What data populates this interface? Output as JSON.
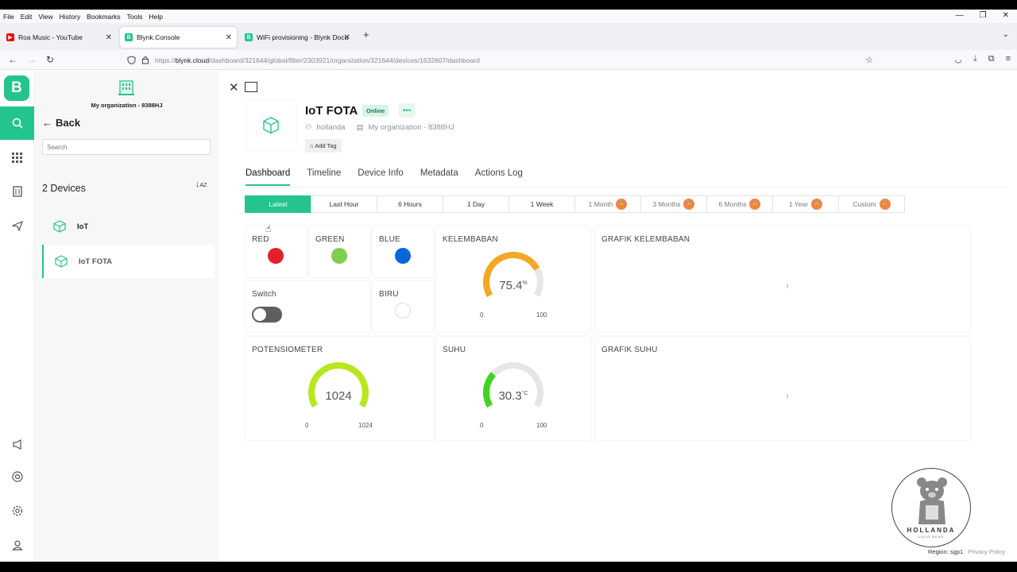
{
  "browser": {
    "menu": [
      "File",
      "Edit",
      "View",
      "History",
      "Bookmarks",
      "Tools",
      "Help"
    ],
    "tabs": [
      {
        "title": "Roa Music - YouTube",
        "favicon_color": "#ff0000"
      },
      {
        "title": "Blynk.Console",
        "favicon_color": "#23c48e"
      },
      {
        "title": "WiFi provisioning - Blynk Docu",
        "favicon_color": "#23c48e"
      }
    ],
    "url_prefix": "https://",
    "url_host": "blynk.cloud",
    "url_path": "/dashboard/321644/global/filter/2303921/organization/321644/devices/1632607/dashboard"
  },
  "rail": {
    "logo": "B"
  },
  "panel": {
    "org_name": "My organization - 8388HJ",
    "back": "Back",
    "search_placeholder": "Search",
    "device_count": "2 Devices",
    "devices": [
      {
        "name": "IoT"
      },
      {
        "name": "IoT FOTA"
      }
    ]
  },
  "device": {
    "title": "IoT FOTA",
    "status": "Online",
    "more": "•••",
    "owner": "hollanda",
    "org": "My organization - 8388HJ",
    "add_tag": "Add Tag"
  },
  "tabs": [
    "Dashboard",
    "Timeline",
    "Device Info",
    "Metadata",
    "Actions Log"
  ],
  "ranges": [
    {
      "label": "Latest",
      "locked": false
    },
    {
      "label": "Last Hour",
      "locked": false
    },
    {
      "label": "6 Hours",
      "locked": false
    },
    {
      "label": "1 Day",
      "locked": false
    },
    {
      "label": "1 Week",
      "locked": false
    },
    {
      "label": "1 Month",
      "locked": true
    },
    {
      "label": "3 Months",
      "locked": true
    },
    {
      "label": "6 Months",
      "locked": true
    },
    {
      "label": "1 Year",
      "locked": true
    },
    {
      "label": "Custom",
      "locked": true
    }
  ],
  "widgets": {
    "red": {
      "title": "RED",
      "color": "#e5202e"
    },
    "green": {
      "title": "GREEN",
      "color": "#7ed04b"
    },
    "blue": {
      "title": "BLUE",
      "color": "#0a66d8"
    },
    "switch": {
      "title": "Switch",
      "state": "off"
    },
    "biru": {
      "title": "BIRU"
    },
    "kelembaban": {
      "title": "KELEMBABAN",
      "value": "75.4",
      "unit": "%",
      "min": "0",
      "max": "100",
      "fraction": 0.754,
      "color": "#f5a623"
    },
    "grafik_kelembaban": {
      "title": "GRAFIK KELEMBABAN"
    },
    "potensiometer": {
      "title": "POTENSIOMETER",
      "value": "1024",
      "min": "0",
      "max": "1024",
      "fraction": 1.0,
      "color": "#b7e81e"
    },
    "suhu": {
      "title": "SUHU",
      "value": "30.3",
      "unit": "°C",
      "min": "0",
      "max": "100",
      "fraction": 0.303,
      "color": "#3fd421"
    },
    "grafik_suhu": {
      "title": "GRAFIK SUHU"
    }
  },
  "watermark": {
    "brand": "HOLLANDA",
    "sub": "LOCO BEAR"
  },
  "footer": {
    "region": "Region: sgp1",
    "privacy": "Privacy Policy"
  }
}
